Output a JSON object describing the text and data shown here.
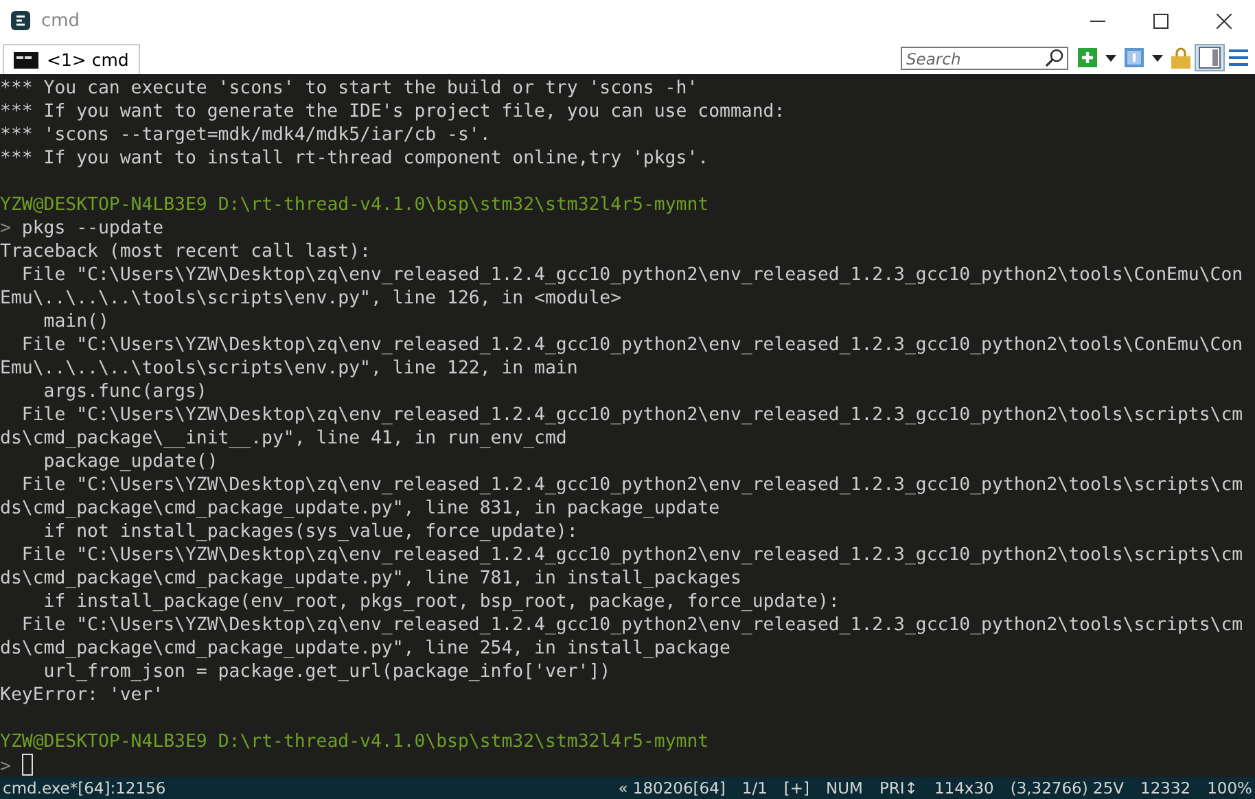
{
  "window": {
    "title": "cmd"
  },
  "tabs": [
    {
      "label": "<1> cmd",
      "selected": true
    }
  ],
  "search": {
    "placeholder": "Search"
  },
  "terminal": {
    "lines": [
      {
        "kind": "text",
        "text": "*** You can execute 'scons' to start the build or try 'scons -h'"
      },
      {
        "kind": "text",
        "text": "*** If you want to generate the IDE's project file, you can use command:"
      },
      {
        "kind": "text",
        "text": "*** 'scons --target=mdk/mdk4/mdk5/iar/cb -s'."
      },
      {
        "kind": "text",
        "text": "*** If you want to install rt-thread component online,try 'pkgs'."
      },
      {
        "kind": "blank"
      },
      {
        "kind": "prompt",
        "user_host": "YZW@DESKTOP-N4LB3E9",
        "path": "D:\\rt-thread-v4.1.0\\bsp\\stm32\\stm32l4r5-mymnt"
      },
      {
        "kind": "input",
        "symbol": ">",
        "command": "pkgs --update",
        "cursor": false
      },
      {
        "kind": "text",
        "text": "Traceback (most recent call last):"
      },
      {
        "kind": "text",
        "text": "  File \"C:\\Users\\YZW\\Desktop\\zq\\env_released_1.2.4_gcc10_python2\\env_released_1.2.3_gcc10_python2\\tools\\ConEmu\\Con"
      },
      {
        "kind": "text",
        "text": "Emu\\..\\..\\..\\tools\\scripts\\env.py\", line 126, in <module>"
      },
      {
        "kind": "text",
        "text": "    main()"
      },
      {
        "kind": "text",
        "text": "  File \"C:\\Users\\YZW\\Desktop\\zq\\env_released_1.2.4_gcc10_python2\\env_released_1.2.3_gcc10_python2\\tools\\ConEmu\\Con"
      },
      {
        "kind": "text",
        "text": "Emu\\..\\..\\..\\tools\\scripts\\env.py\", line 122, in main"
      },
      {
        "kind": "text",
        "text": "    args.func(args)"
      },
      {
        "kind": "text",
        "text": "  File \"C:\\Users\\YZW\\Desktop\\zq\\env_released_1.2.4_gcc10_python2\\env_released_1.2.3_gcc10_python2\\tools\\scripts\\cm"
      },
      {
        "kind": "text",
        "text": "ds\\cmd_package\\__init__.py\", line 41, in run_env_cmd"
      },
      {
        "kind": "text",
        "text": "    package_update()"
      },
      {
        "kind": "text",
        "text": "  File \"C:\\Users\\YZW\\Desktop\\zq\\env_released_1.2.4_gcc10_python2\\env_released_1.2.3_gcc10_python2\\tools\\scripts\\cm"
      },
      {
        "kind": "text",
        "text": "ds\\cmd_package\\cmd_package_update.py\", line 831, in package_update"
      },
      {
        "kind": "text",
        "text": "    if not install_packages(sys_value, force_update):"
      },
      {
        "kind": "text",
        "text": "  File \"C:\\Users\\YZW\\Desktop\\zq\\env_released_1.2.4_gcc10_python2\\env_released_1.2.3_gcc10_python2\\tools\\scripts\\cm"
      },
      {
        "kind": "text",
        "text": "ds\\cmd_package\\cmd_package_update.py\", line 781, in install_packages"
      },
      {
        "kind": "text",
        "text": "    if install_package(env_root, pkgs_root, bsp_root, package, force_update):"
      },
      {
        "kind": "text",
        "text": "  File \"C:\\Users\\YZW\\Desktop\\zq\\env_released_1.2.4_gcc10_python2\\env_released_1.2.3_gcc10_python2\\tools\\scripts\\cm"
      },
      {
        "kind": "text",
        "text": "ds\\cmd_package\\cmd_package_update.py\", line 254, in install_package"
      },
      {
        "kind": "text",
        "text": "    url_from_json = package.get_url(package_info['ver'])"
      },
      {
        "kind": "text",
        "text": "KeyError: 'ver'"
      },
      {
        "kind": "blank"
      },
      {
        "kind": "prompt",
        "user_host": "YZW@DESKTOP-N4LB3E9",
        "path": "D:\\rt-thread-v4.1.0\\bsp\\stm32\\stm32l4r5-mymnt"
      },
      {
        "kind": "input",
        "symbol": ">",
        "cursor": true
      }
    ]
  },
  "status_bar": {
    "left": "cmd.exe*[64]:12156",
    "fields": [
      "« 180206[64]",
      "1/1",
      "[+]",
      "NUM",
      "PRI↕",
      "114x30",
      "(3,32766) 25V",
      "12332",
      "100%"
    ]
  }
}
